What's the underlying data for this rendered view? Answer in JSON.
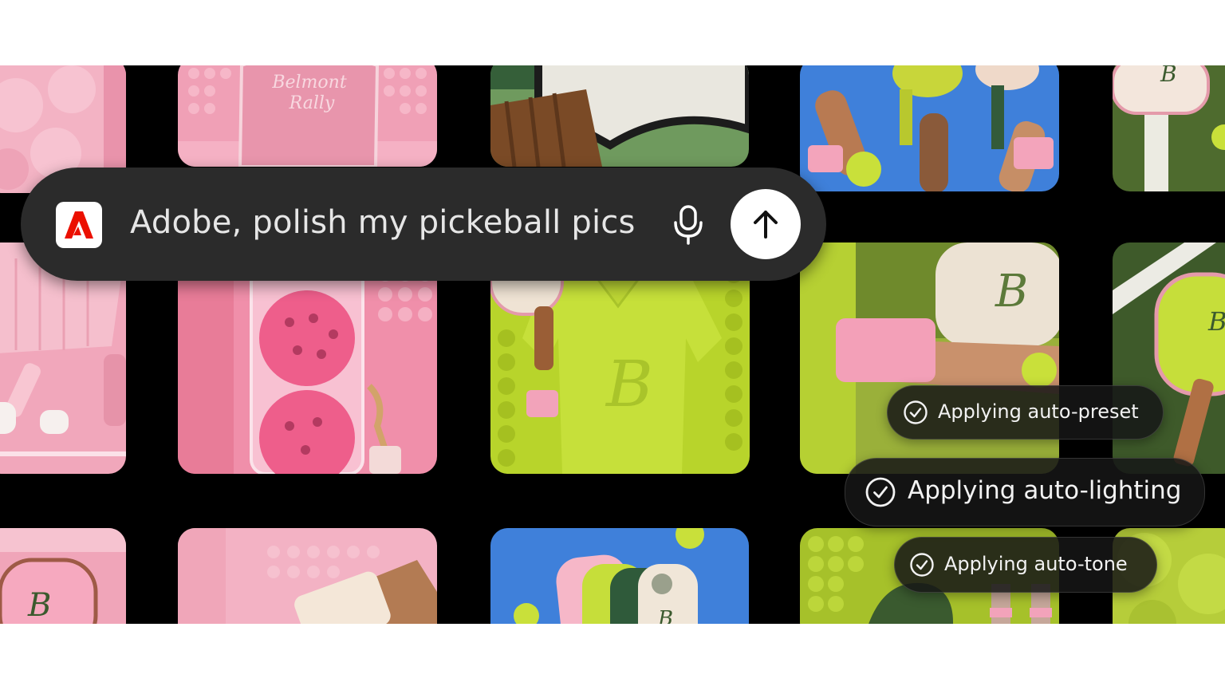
{
  "prompt": {
    "text": "Adobe, polish my pickeball pics",
    "logo_icon": "adobe-logo-icon",
    "mic_icon": "microphone-icon",
    "send_icon": "arrow-up-icon"
  },
  "status_items": [
    {
      "label": "Applying auto-preset",
      "icon": "check-circle-icon"
    },
    {
      "label": "Applying auto-lighting",
      "icon": "check-circle-icon"
    },
    {
      "label": "Applying auto-tone",
      "icon": "check-circle-icon"
    }
  ],
  "photo_tiles": [
    "pink-quilted-outfit",
    "pink-paddle-bag",
    "paddle-handle-closeup",
    "raised-paddles-sky",
    "green-paddle-court",
    "pink-skirt-socks",
    "pink-ball-jar",
    "green-polo-player",
    "pink-wristband",
    "green-paddles-court",
    "pink-paddle-corner",
    "pink-sock-closeup",
    "paddle-stack-sky",
    "green-bag-tennis-wall",
    "green-quilted-fabric"
  ],
  "tile_texts": {
    "bag_text_line1": "Belmont",
    "bag_text_line2": "Rally",
    "paddle_monogram": "B"
  },
  "colors": {
    "adobe_red": "#eb1000",
    "prompt_bg": "#2b2b2b",
    "pink": "#f2a9bf",
    "lime": "#b5d630",
    "court_green": "#4d6a2c",
    "sky_blue": "#3f7fd6"
  }
}
